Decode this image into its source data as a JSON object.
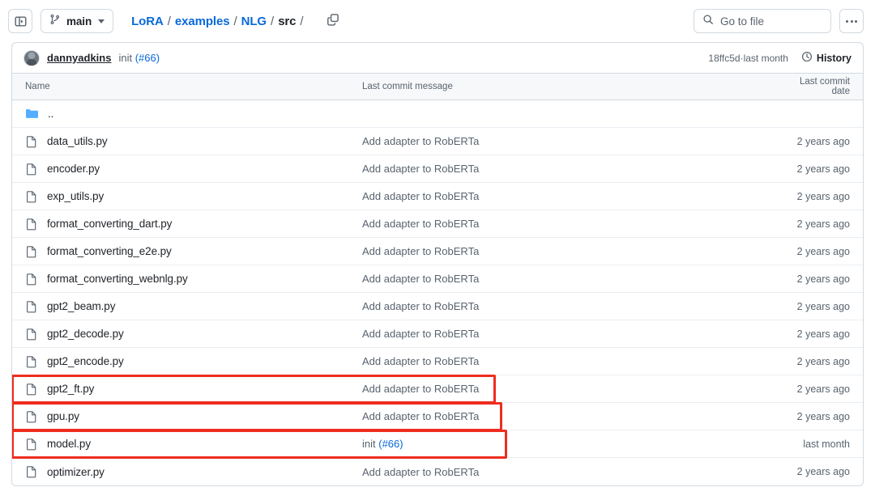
{
  "toolbar": {
    "sidebar_toggle_icon": "sidebar-expand-icon",
    "branch": {
      "icon": "git-branch-icon",
      "name": "main",
      "caret_icon": "chevron-down-icon"
    },
    "breadcrumb": {
      "items": [
        {
          "label": "LoRA",
          "type": "link"
        },
        {
          "label": "examples",
          "type": "link"
        },
        {
          "label": "NLG",
          "type": "link"
        },
        {
          "label": "src",
          "type": "current"
        }
      ],
      "separator": "/",
      "trailing_separator": "/"
    },
    "copy_path_icon": "copy-icon",
    "search": {
      "icon": "search-icon",
      "placeholder": "Go to file"
    },
    "more_menu_label": "more-options"
  },
  "commit_bar": {
    "avatar_alt": "dannyadkins-avatar",
    "author": "dannyadkins",
    "message_text": "init ",
    "message_pr": "(#66)",
    "hash": "18ffc5d",
    "separator": " · ",
    "relative_time": "last month",
    "history_icon": "history-clock-icon",
    "history_label": "History"
  },
  "table": {
    "columns": {
      "name": "Name",
      "message": "Last commit message",
      "date": "Last commit date"
    },
    "rows": [
      {
        "name": "..",
        "icon": "folder-icon",
        "message": "",
        "message_pr": "",
        "date": "",
        "highlighted": false
      },
      {
        "name": "data_utils.py",
        "icon": "file-icon",
        "message": "Add adapter to RobERTa",
        "message_pr": "",
        "date": "2 years ago",
        "highlighted": false
      },
      {
        "name": "encoder.py",
        "icon": "file-icon",
        "message": "Add adapter to RobERTa",
        "message_pr": "",
        "date": "2 years ago",
        "highlighted": false
      },
      {
        "name": "exp_utils.py",
        "icon": "file-icon",
        "message": "Add adapter to RobERTa",
        "message_pr": "",
        "date": "2 years ago",
        "highlighted": false
      },
      {
        "name": "format_converting_dart.py",
        "icon": "file-icon",
        "message": "Add adapter to RobERTa",
        "message_pr": "",
        "date": "2 years ago",
        "highlighted": false
      },
      {
        "name": "format_converting_e2e.py",
        "icon": "file-icon",
        "message": "Add adapter to RobERTa",
        "message_pr": "",
        "date": "2 years ago",
        "highlighted": false
      },
      {
        "name": "format_converting_webnlg.py",
        "icon": "file-icon",
        "message": "Add adapter to RobERTa",
        "message_pr": "",
        "date": "2 years ago",
        "highlighted": false
      },
      {
        "name": "gpt2_beam.py",
        "icon": "file-icon",
        "message": "Add adapter to RobERTa",
        "message_pr": "",
        "date": "2 years ago",
        "highlighted": false
      },
      {
        "name": "gpt2_decode.py",
        "icon": "file-icon",
        "message": "Add adapter to RobERTa",
        "message_pr": "",
        "date": "2 years ago",
        "highlighted": false
      },
      {
        "name": "gpt2_encode.py",
        "icon": "file-icon",
        "message": "Add adapter to RobERTa",
        "message_pr": "",
        "date": "2 years ago",
        "highlighted": false
      },
      {
        "name": "gpt2_ft.py",
        "icon": "file-icon",
        "message": "Add adapter to RobERTa",
        "message_pr": "",
        "date": "2 years ago",
        "highlighted": true,
        "highlight_width": 598
      },
      {
        "name": "gpu.py",
        "icon": "file-icon",
        "message": "Add adapter to RobERTa",
        "message_pr": "",
        "date": "2 years ago",
        "highlighted": true,
        "highlight_width": 606
      },
      {
        "name": "model.py",
        "icon": "file-icon",
        "message": "init ",
        "message_pr": "(#66)",
        "date": "last month",
        "highlighted": true,
        "highlight_width": 612
      },
      {
        "name": "optimizer.py",
        "icon": "file-icon",
        "message": "Add adapter to RobERTa",
        "message_pr": "",
        "date": "2 years ago",
        "highlighted": false
      }
    ]
  },
  "colors": {
    "link": "#0969da",
    "muted": "#59636e",
    "border": "#d1d9e0",
    "annotation": "#ee2d1f",
    "folder": "#54aeff"
  }
}
